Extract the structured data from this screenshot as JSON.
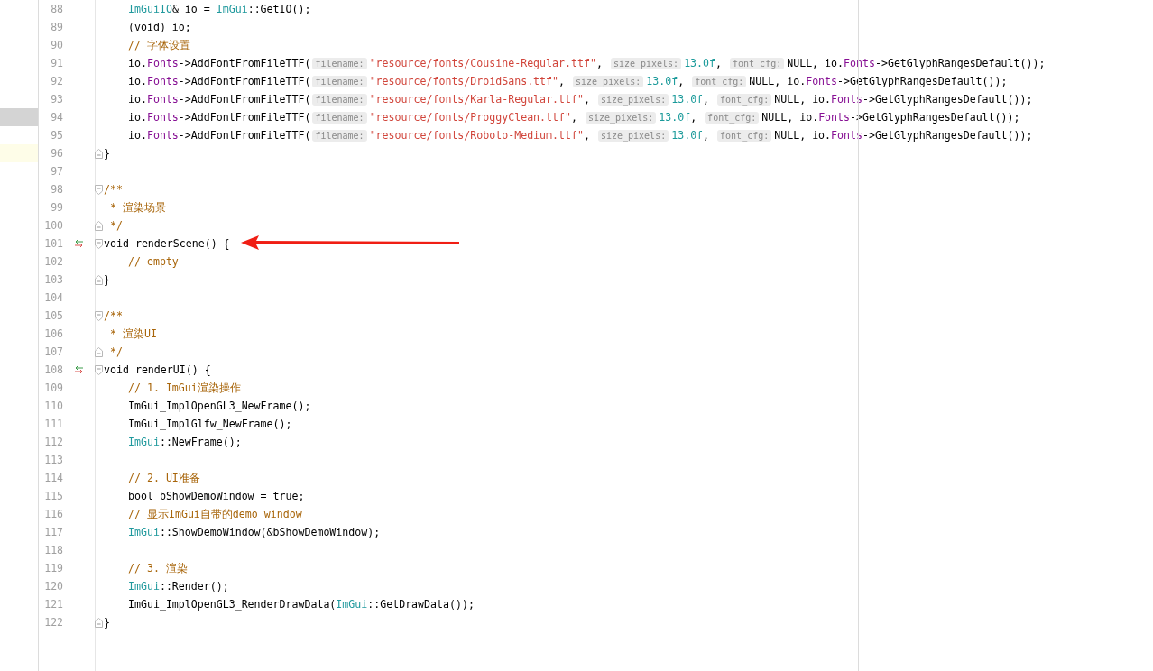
{
  "editor": {
    "lines": [
      {
        "number": "88",
        "indent": true,
        "tokens": [
          {
            "kind": "type",
            "text": "ImGuiIO"
          },
          {
            "kind": "plain",
            "text": "& io = "
          },
          {
            "kind": "type",
            "text": "ImGui"
          },
          {
            "kind": "plain",
            "text": "::GetIO();"
          }
        ]
      },
      {
        "number": "89",
        "indent": true,
        "tokens": [
          {
            "kind": "plain",
            "text": "(void) io;"
          }
        ]
      },
      {
        "number": "90",
        "indent": true,
        "tokens": [
          {
            "kind": "comment",
            "text": "// 字体设置"
          }
        ]
      },
      {
        "number": "91",
        "indent": true,
        "tokens": [
          {
            "kind": "plain",
            "text": "io."
          },
          {
            "kind": "member",
            "text": "Fonts"
          },
          {
            "kind": "plain",
            "text": "->AddFontFromFileTTF("
          },
          {
            "kind": "hint",
            "text": "filename:"
          },
          {
            "kind": "string",
            "text": "\"resource/fonts/Cousine-Regular.ttf\""
          },
          {
            "kind": "plain",
            "text": ", "
          },
          {
            "kind": "hint",
            "text": "size_pixels:"
          },
          {
            "kind": "number",
            "text": "13.0f"
          },
          {
            "kind": "plain",
            "text": ", "
          },
          {
            "kind": "hint",
            "text": "font_cfg:"
          },
          {
            "kind": "plain",
            "text": "NULL, io."
          },
          {
            "kind": "member",
            "text": "Fonts"
          },
          {
            "kind": "plain",
            "text": "->GetGlyphRangesDefault());"
          }
        ]
      },
      {
        "number": "92",
        "indent": true,
        "tokens": [
          {
            "kind": "plain",
            "text": "io."
          },
          {
            "kind": "member",
            "text": "Fonts"
          },
          {
            "kind": "plain",
            "text": "->AddFontFromFileTTF("
          },
          {
            "kind": "hint",
            "text": "filename:"
          },
          {
            "kind": "string",
            "text": "\"resource/fonts/DroidSans.ttf\""
          },
          {
            "kind": "plain",
            "text": ", "
          },
          {
            "kind": "hint",
            "text": "size_pixels:"
          },
          {
            "kind": "number",
            "text": "13.0f"
          },
          {
            "kind": "plain",
            "text": ", "
          },
          {
            "kind": "hint",
            "text": "font_cfg:"
          },
          {
            "kind": "plain",
            "text": "NULL, io."
          },
          {
            "kind": "member",
            "text": "Fonts"
          },
          {
            "kind": "plain",
            "text": "->GetGlyphRangesDefault());"
          }
        ]
      },
      {
        "number": "93",
        "indent": true,
        "tokens": [
          {
            "kind": "plain",
            "text": "io."
          },
          {
            "kind": "member",
            "text": "Fonts"
          },
          {
            "kind": "plain",
            "text": "->AddFontFromFileTTF("
          },
          {
            "kind": "hint",
            "text": "filename:"
          },
          {
            "kind": "string",
            "text": "\"resource/fonts/Karla-Regular.ttf\""
          },
          {
            "kind": "plain",
            "text": ", "
          },
          {
            "kind": "hint",
            "text": "size_pixels:"
          },
          {
            "kind": "number",
            "text": "13.0f"
          },
          {
            "kind": "plain",
            "text": ", "
          },
          {
            "kind": "hint",
            "text": "font_cfg:"
          },
          {
            "kind": "plain",
            "text": "NULL, io."
          },
          {
            "kind": "member",
            "text": "Fonts"
          },
          {
            "kind": "plain",
            "text": "->GetGlyphRangesDefault());"
          }
        ]
      },
      {
        "number": "94",
        "indent": true,
        "highlighted": true,
        "tokens": [
          {
            "kind": "plain",
            "text": "io."
          },
          {
            "kind": "member",
            "text": "Fonts"
          },
          {
            "kind": "plain",
            "text": "->AddFontFromFileTTF("
          },
          {
            "kind": "hint",
            "text": "filename:"
          },
          {
            "kind": "string",
            "text": "\"resource/fonts/ProggyClean.ttf\""
          },
          {
            "kind": "plain",
            "text": ", "
          },
          {
            "kind": "hint",
            "text": "size_pixels:"
          },
          {
            "kind": "number",
            "text": "13.0f"
          },
          {
            "kind": "plain",
            "text": ", "
          },
          {
            "kind": "hint",
            "text": "font_cfg:"
          },
          {
            "kind": "plain",
            "text": "NULL, io."
          },
          {
            "kind": "member",
            "text": "Fonts"
          },
          {
            "kind": "plain",
            "text": "->GetGlyphRangesDefault());"
          }
        ]
      },
      {
        "number": "95",
        "indent": true,
        "tokens": [
          {
            "kind": "plain",
            "text": "io."
          },
          {
            "kind": "member",
            "text": "Fonts"
          },
          {
            "kind": "plain",
            "text": "->AddFontFromFileTTF("
          },
          {
            "kind": "hint",
            "text": "filename:"
          },
          {
            "kind": "string",
            "text": "\"resource/fonts/Roboto-Medium.ttf\""
          },
          {
            "kind": "plain",
            "text": ", "
          },
          {
            "kind": "hint",
            "text": "size_pixels:"
          },
          {
            "kind": "number",
            "text": "13.0f"
          },
          {
            "kind": "plain",
            "text": ", "
          },
          {
            "kind": "hint",
            "text": "font_cfg:"
          },
          {
            "kind": "plain",
            "text": "NULL, io."
          },
          {
            "kind": "member",
            "text": "Fonts"
          },
          {
            "kind": "plain",
            "text": "->GetGlyphRangesDefault());"
          }
        ]
      },
      {
        "number": "96",
        "fold_end": true,
        "current_line": true,
        "tokens": [
          {
            "kind": "plain",
            "text": "}"
          }
        ]
      },
      {
        "number": "97"
      },
      {
        "number": "98",
        "fold_start": true,
        "tokens": [
          {
            "kind": "comment",
            "text": "/**"
          }
        ]
      },
      {
        "number": "99",
        "tokens": [
          {
            "kind": "comment",
            "text": " * 渲染场景"
          }
        ]
      },
      {
        "number": "100",
        "fold_end": true,
        "tokens": [
          {
            "kind": "comment",
            "text": " */"
          }
        ]
      },
      {
        "number": "101",
        "fold_start": true,
        "marker": true,
        "tokens": [
          {
            "kind": "plain",
            "text": "void renderScene() {"
          }
        ]
      },
      {
        "number": "102",
        "indent": true,
        "tokens": [
          {
            "kind": "comment",
            "text": "// empty"
          }
        ]
      },
      {
        "number": "103",
        "fold_end": true,
        "tokens": [
          {
            "kind": "plain",
            "text": "}"
          }
        ]
      },
      {
        "number": "104"
      },
      {
        "number": "105",
        "fold_start": true,
        "tokens": [
          {
            "kind": "comment",
            "text": "/**"
          }
        ]
      },
      {
        "number": "106",
        "tokens": [
          {
            "kind": "comment",
            "text": " * 渲染UI"
          }
        ]
      },
      {
        "number": "107",
        "fold_end": true,
        "tokens": [
          {
            "kind": "comment",
            "text": " */"
          }
        ]
      },
      {
        "number": "108",
        "fold_start": true,
        "marker": true,
        "tokens": [
          {
            "kind": "plain",
            "text": "void renderUI() {"
          }
        ]
      },
      {
        "number": "109",
        "indent": true,
        "tokens": [
          {
            "kind": "comment",
            "text": "// 1. ImGui渲染操作"
          }
        ]
      },
      {
        "number": "110",
        "indent": true,
        "tokens": [
          {
            "kind": "plain",
            "text": "ImGui_ImplOpenGL3_NewFrame();"
          }
        ]
      },
      {
        "number": "111",
        "indent": true,
        "tokens": [
          {
            "kind": "plain",
            "text": "ImGui_ImplGlfw_NewFrame();"
          }
        ]
      },
      {
        "number": "112",
        "indent": true,
        "tokens": [
          {
            "kind": "type",
            "text": "ImGui"
          },
          {
            "kind": "plain",
            "text": "::NewFrame();"
          }
        ]
      },
      {
        "number": "113"
      },
      {
        "number": "114",
        "indent": true,
        "tokens": [
          {
            "kind": "comment",
            "text": "// 2. UI准备"
          }
        ]
      },
      {
        "number": "115",
        "indent": true,
        "tokens": [
          {
            "kind": "plain",
            "text": "bool bShowDemoWindow = true;"
          }
        ]
      },
      {
        "number": "116",
        "indent": true,
        "tokens": [
          {
            "kind": "comment",
            "text": "// 显示ImGui自带的demo window"
          }
        ]
      },
      {
        "number": "117",
        "indent": true,
        "tokens": [
          {
            "kind": "type",
            "text": "ImGui"
          },
          {
            "kind": "plain",
            "text": "::ShowDemoWindow(&bShowDemoWindow);"
          }
        ]
      },
      {
        "number": "118"
      },
      {
        "number": "119",
        "indent": true,
        "tokens": [
          {
            "kind": "comment",
            "text": "// 3. 渲染"
          }
        ]
      },
      {
        "number": "120",
        "indent": true,
        "tokens": [
          {
            "kind": "type",
            "text": "ImGui"
          },
          {
            "kind": "plain",
            "text": "::Render();"
          }
        ]
      },
      {
        "number": "121",
        "indent": true,
        "tokens": [
          {
            "kind": "plain",
            "text": "ImGui_ImplOpenGL3_RenderDrawData("
          },
          {
            "kind": "type",
            "text": "ImGui"
          },
          {
            "kind": "plain",
            "text": "::GetDrawData());"
          }
        ]
      },
      {
        "number": "122",
        "fold_end": true,
        "tokens": [
          {
            "kind": "plain",
            "text": "}"
          }
        ]
      }
    ]
  }
}
